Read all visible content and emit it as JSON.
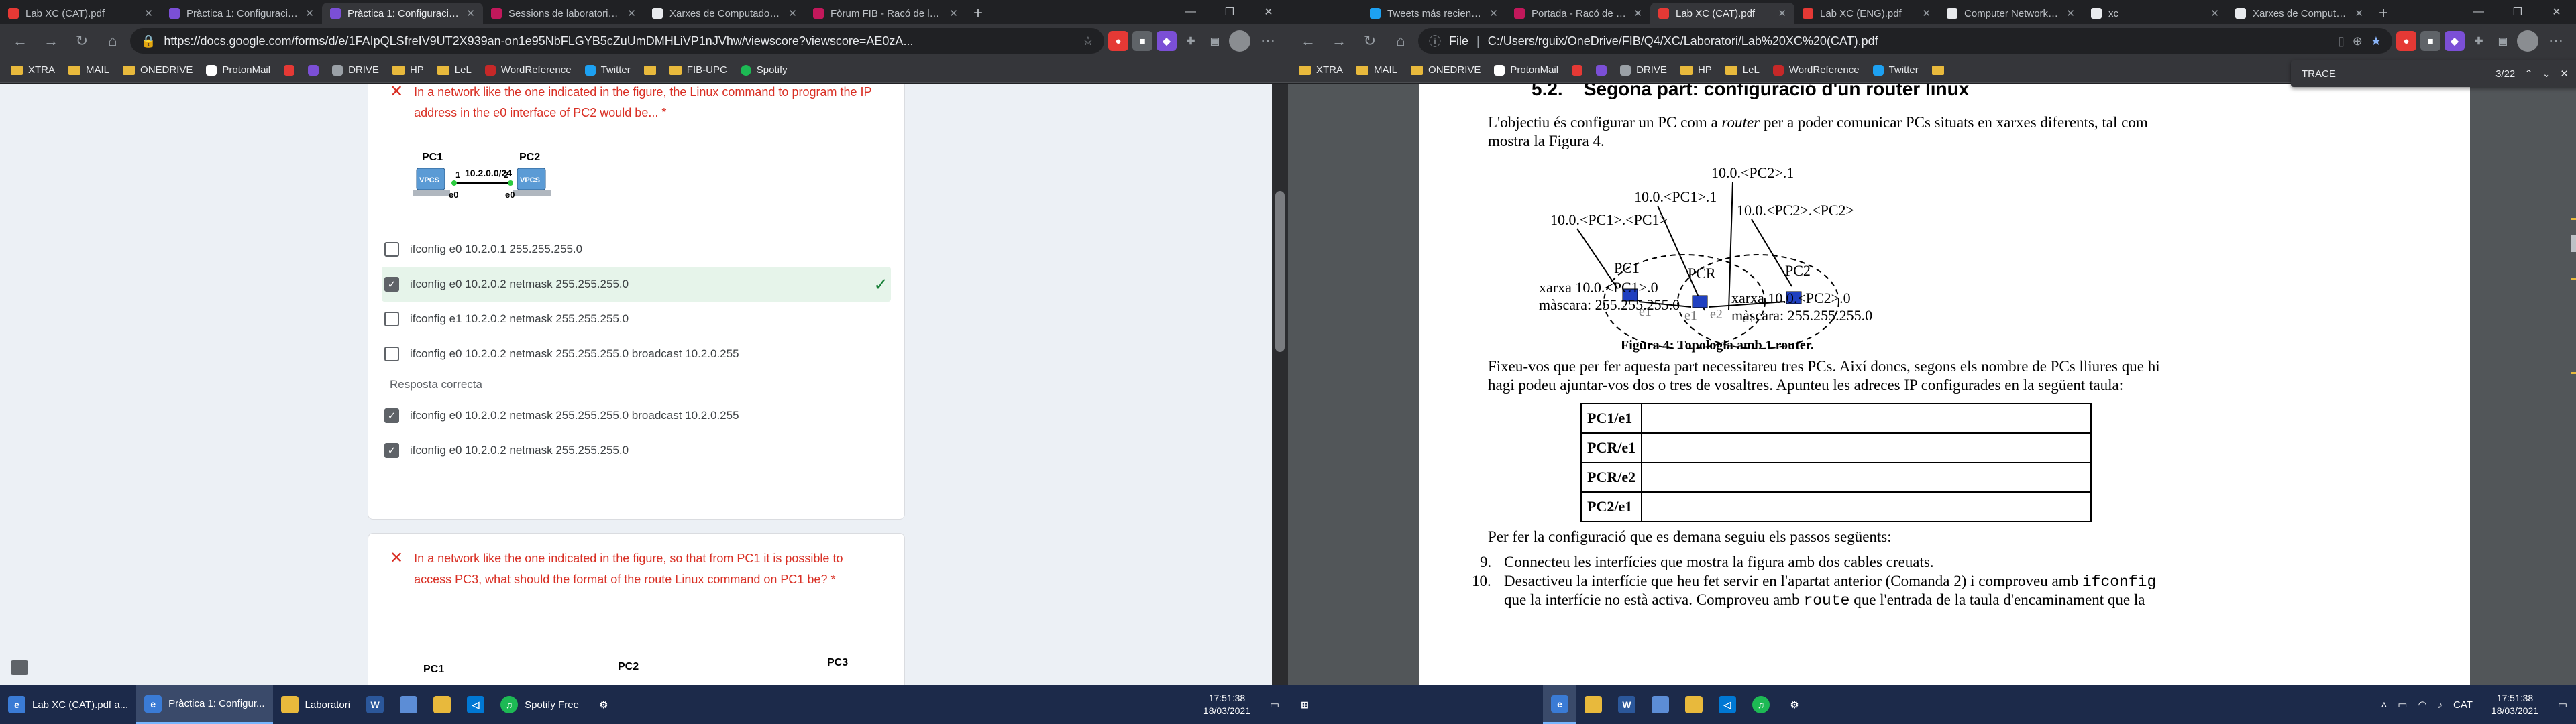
{
  "left": {
    "tabs": [
      {
        "title": "Lab XC (CAT).pdf",
        "color": "#e53935"
      },
      {
        "title": "Pràctica 1: Configuració d'i...",
        "color": "#7b4fd6"
      },
      {
        "title": "Pràctica 1: Configuració d'i...",
        "color": "#7b4fd6"
      },
      {
        "title": "Sessions de laboratori i gru...",
        "color": "#c2185b"
      },
      {
        "title": "Xarxes de Computadors, gu...",
        "color": "#e8eaed"
      },
      {
        "title": "Fòrum FIB - Racó de la FIB",
        "color": "#c2185b"
      }
    ],
    "url": "https://docs.google.com/forms/d/e/1FAIpQLSfreIV9UT2X939an-on1e95NbFLGYB5cZuUmDMHLiVP1nJVhw/viewscore?viewscore=AE0zA...",
    "bookmarks": [
      "XTRA",
      "MAIL",
      "ONEDRIVE",
      "ProtonMail",
      "",
      "DRIVE",
      "HP",
      "LeL",
      "WordReference",
      "Twitter",
      "",
      "FIB-UPC",
      "Spotify"
    ],
    "q1": {
      "text": "In a network like the one indicated in the figure, the Linux command to program the IP address in the e0 interface of PC2 would be... *",
      "fig": {
        "pc1": "PC1",
        "pc2": "PC2",
        "net": "10.2.0.0/24",
        "p1": "1",
        "p2": "2",
        "if1": "e0",
        "if2": "e0",
        "vpcs": "VPCS"
      },
      "options": [
        {
          "label": "ifconfig e0 10.2.0.1 255.255.255.0",
          "checked": false
        },
        {
          "label": "ifconfig e0 10.2.0.2 netmask 255.255.255.0",
          "checked": true
        },
        {
          "label": "ifconfig e1 10.2.0.2 netmask 255.255.255.0",
          "checked": false
        },
        {
          "label": "ifconfig e0 10.2.0.2 netmask 255.255.255.0 broadcast 10.2.0.255",
          "checked": false
        }
      ],
      "correct_title": "Resposta correcta",
      "correct": [
        "ifconfig e0 10.2.0.2 netmask 255.255.255.0 broadcast 10.2.0.255",
        "ifconfig e0 10.2.0.2 netmask 255.255.255.0"
      ]
    },
    "q2": {
      "text": "In a network like the one indicated in the figure, so that from PC1 it is possible to access PC3, what should the format of the route Linux command on PC1 be? *",
      "fig": {
        "pc1": "PC1",
        "pc2": "PC2",
        "pc3": "PC3"
      }
    },
    "taskbar": [
      {
        "label": "Lab XC (CAT).pdf a...",
        "color": "#3a7bd5"
      },
      {
        "label": "Pràctica 1: Configur...",
        "color": "#3a7bd5"
      },
      {
        "label": "Laboratori",
        "color": "#e8b93c"
      },
      {
        "label": "",
        "color": "#2b579a"
      },
      {
        "label": "",
        "color": "#5c8dd6"
      },
      {
        "label": "",
        "color": "#e8b93c"
      },
      {
        "label": "",
        "color": "#0078d4"
      },
      {
        "label": "Spotify Free",
        "color": "#1db954"
      },
      {
        "label": "",
        "color": "#5f6368"
      }
    ],
    "clock": {
      "time": "17:51:38",
      "date": "18/03/2021"
    }
  },
  "right": {
    "tabs": [
      {
        "title": "Tweets más recientes...",
        "color": "#1da1f2"
      },
      {
        "title": "Portada - Racó de la F...",
        "color": "#c2185b"
      },
      {
        "title": "Lab XC (CAT).pdf",
        "color": "#e53935"
      },
      {
        "title": "Lab XC (ENG).pdf",
        "color": "#e53935"
      },
      {
        "title": "Computer Networks ...",
        "color": "#e8eaed"
      },
      {
        "title": "xc",
        "color": "#e8eaed"
      },
      {
        "title": "Xarxes de Computado...",
        "color": "#e8eaed"
      }
    ],
    "url": "C:/Users/rguix/OneDrive/FIB/Q4/XC/Laboratori/Lab%20XC%20(CAT).pdf",
    "url_prefix": "File",
    "bookmarks": [
      "XTRA",
      "MAIL",
      "ONEDRIVE",
      "ProtonMail",
      "",
      "DRIVE",
      "HP",
      "LeL",
      "WordReference",
      "Twitter",
      ""
    ],
    "find": {
      "query": "TRACE",
      "count": "3/22"
    },
    "doc": {
      "section_num": "5.2.",
      "section_title": "Segona part: configuració d'un router linux",
      "p1a": "L'objectiu és configurar un PC com a ",
      "p1_router": "router",
      "p1b": " per a poder comunicar PCs situats en xarxes diferents, tal com",
      "p1c": "mostra la Figura 4.",
      "fig": {
        "l_pc2_1": "10.0.<PC2>.1",
        "l_pc1_1": "10.0.<PC1>.1",
        "l_pc2_pc2": "10.0.<PC2>.<PC2>",
        "l_pc1_pc1": "10.0.<PC1>.<PC1>",
        "pc1": "PC1",
        "pcr": "PCR",
        "pc2": "PC2",
        "e1a": "e1",
        "e1b": "e1",
        "e2": "e2",
        "e1c": "e1",
        "net1": "xarxa 10.0.<PC1>.0",
        "mask1": "màscara: 255.255.255.0",
        "net2": "xarxa 10.0.<PC2>.0",
        "mask2": "màscara: 255.255.255.0",
        "caption": "Figura 4: Topologia amb 1 router."
      },
      "p2a": "Fixeu-vos que per fer aquesta part necessitareu tres PCs. Així doncs, segons els nombre de PCs lliures que hi",
      "p2b": "hagi podeu ajuntar-vos dos o tres de vosaltres. Apunteu les adreces IP configurades en la següent taula:",
      "table": [
        "PC1/e1",
        "PCR/e1",
        "PCR/e2",
        "PC2/e1"
      ],
      "p3": "Per fer la configuració que es demana seguiu els passos següents:",
      "step9_num": "9.",
      "step9": "Connecteu les interfícies que mostra la figura amb dos cables creuats.",
      "step10_num": "10.",
      "step10a": "Desactiveu la interfície que heu fet servir en l'apartat anterior (Comanda 2) i comproveu amb ",
      "step10_cmd": "ifconfig",
      "step10b": "que la interfície no està activa. Comproveu amb ",
      "step10_cmd2": "route",
      "step10c": " que l'entrada de la taula d'encaminament que la"
    },
    "taskbar": [
      {
        "label": "",
        "color": "#3a7bd5"
      },
      {
        "label": "",
        "color": "#e8b93c"
      },
      {
        "label": "",
        "color": "#2b579a"
      },
      {
        "label": "",
        "color": "#5c8dd6"
      },
      {
        "label": "",
        "color": "#e8b93c"
      },
      {
        "label": "",
        "color": "#0078d4"
      },
      {
        "label": "",
        "color": "#1db954"
      },
      {
        "label": "",
        "color": "#5f6368"
      }
    ],
    "tray_lang": "CAT",
    "clock": {
      "time": "17:51:38",
      "date": "18/03/2021"
    }
  }
}
